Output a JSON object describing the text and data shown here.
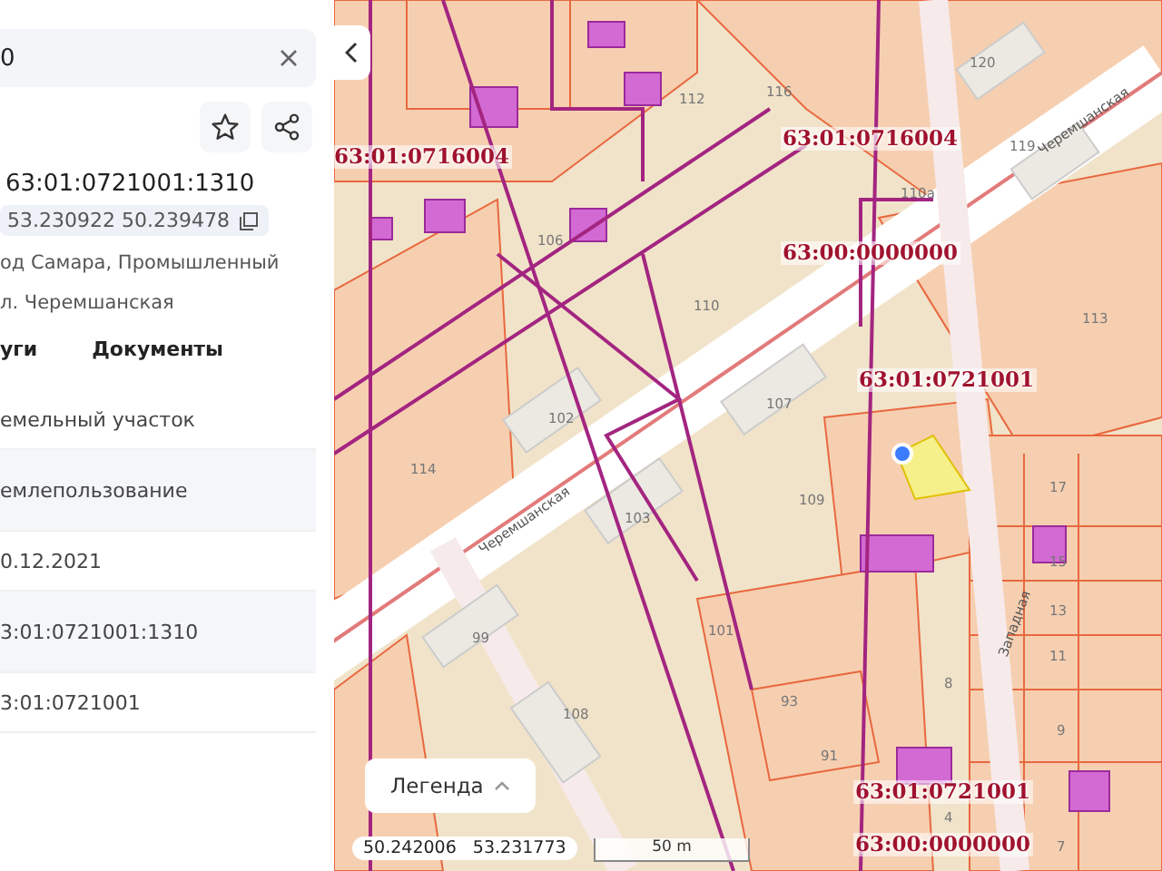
{
  "panel": {
    "search": {
      "value": "0"
    },
    "title": "63:01:0721001:1310",
    "coords": "53.230922 50.239478",
    "address": [
      "од Самара, Промышленный",
      "л. Черемшанская"
    ],
    "tabs": [
      {
        "label": "уги"
      },
      {
        "label": "Документы"
      }
    ],
    "rows": [
      {
        "value": "емельный участок",
        "highlighted": false
      },
      {
        "value": "емлепользование",
        "highlighted": true
      },
      {
        "value": "0.12.2021",
        "highlighted": false
      },
      {
        "value": "3:01:0721001:1310",
        "highlighted": true
      },
      {
        "value": "3:01:0721001",
        "highlighted": false
      }
    ]
  },
  "map": {
    "cadastral_labels": [
      "63:01:0716004",
      "63:01:0716004",
      "63:00:0000000",
      "63:01:0721001",
      "63:01:0721001",
      "63:00:0000000"
    ],
    "house_numbers": [
      "120",
      "119",
      "116",
      "112",
      "110а",
      "113",
      "106",
      "110",
      "102",
      "107",
      "114",
      "103",
      "109",
      "17",
      "15",
      "13",
      "11",
      "101",
      "99",
      "108",
      "93",
      "9",
      "8",
      "7",
      "4",
      "91"
    ],
    "streets": [
      "Черемшанская",
      "Черемшанская",
      "Западная"
    ],
    "legend": "Легенда",
    "cursor": "50.242006   53.231773",
    "scale": "50 m"
  }
}
